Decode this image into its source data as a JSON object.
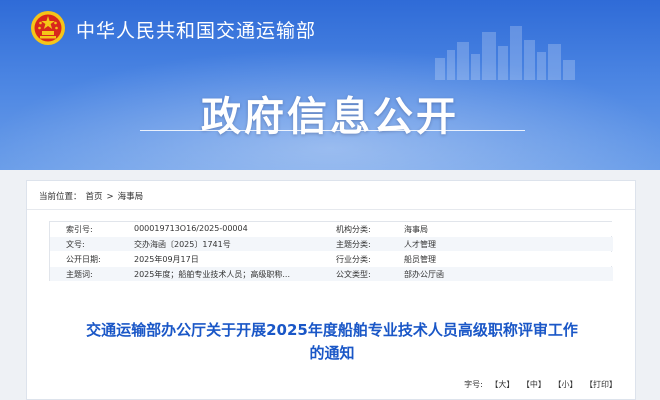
{
  "header": {
    "ministry_name": "中华人民共和国交通运输部",
    "banner_title": "政府信息公开"
  },
  "breadcrumb": {
    "label": "当前位置：",
    "home": "首页",
    "separator": ">",
    "current": "海事局"
  },
  "metadata": {
    "rows": [
      {
        "k1": "索引号:",
        "v1": "000019713O16/2025-00004",
        "k2": "机构分类:",
        "v2": "海事局"
      },
      {
        "k1": "文号:",
        "v1": "交办海函〔2025〕1741号",
        "k2": "主题分类:",
        "v2": "人才管理"
      },
      {
        "k1": "公开日期:",
        "v1": "2025年09月17日",
        "k2": "行业分类:",
        "v2": "船员管理"
      },
      {
        "k1": "主题词:",
        "v1": "2025年度；船舶专业技术人员；高级职称...",
        "k2": "公文类型:",
        "v2": "部办公厅函"
      }
    ]
  },
  "document": {
    "title_line1": "交通运输部办公厅关于开展2025年度船舶专业技术人员高级职称评审工作",
    "title_line2": "的通知"
  },
  "font_size": {
    "label": "字号:",
    "large": "【大】",
    "medium": "【中】",
    "small": "【小】",
    "print": "【打印】"
  },
  "colors": {
    "banner_blue": "#2f6bd7",
    "title_blue": "#1a57c7",
    "emblem_red": "#d8261c",
    "emblem_gold": "#f5c518"
  }
}
